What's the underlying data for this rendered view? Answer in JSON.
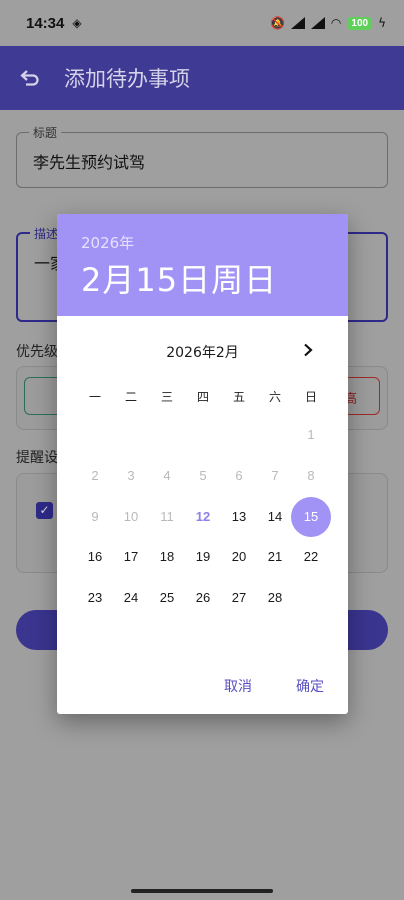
{
  "status": {
    "time": "14:34",
    "battery": "100"
  },
  "app": {
    "title": "添加待办事项"
  },
  "form": {
    "title_label": "标题",
    "title_value": "李先生预约试驾",
    "desc_label": "描述",
    "desc_value": "一家",
    "priority_label": "优先级",
    "priority_high_label": "高",
    "reminder_label": "提醒设"
  },
  "dialog": {
    "header_year": "2026年",
    "header_date": "2月15日周日",
    "month_label": "2026年2月",
    "weekdays": [
      "一",
      "二",
      "三",
      "四",
      "五",
      "六",
      "日"
    ],
    "disabled_days": [
      "1",
      "2",
      "3",
      "4",
      "5",
      "6",
      "7",
      "8",
      "9",
      "10",
      "11"
    ],
    "today": "12",
    "selected": "15",
    "enabled_days": [
      "13",
      "14",
      "16",
      "17",
      "18",
      "19",
      "20",
      "21",
      "22",
      "23",
      "24",
      "25",
      "26",
      "27",
      "28"
    ],
    "cancel_label": "取消",
    "ok_label": "确定"
  },
  "colors": {
    "accent": "#a192f6",
    "primary": "#3f3a93",
    "action_text": "#5a4fc4"
  },
  "icons": [
    "back-arrow-icon",
    "chevron-right-icon",
    "checkbox-checked-icon"
  ]
}
